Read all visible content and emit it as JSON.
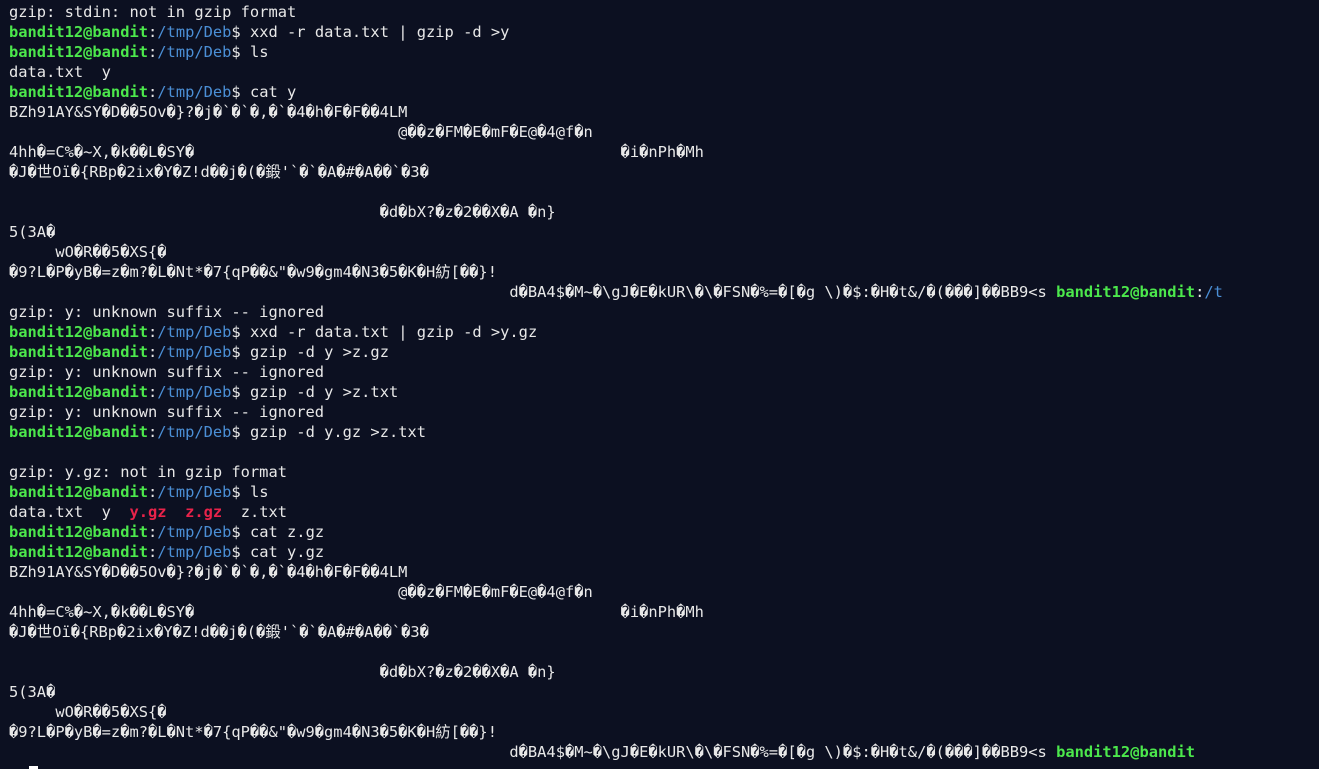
{
  "prompt": {
    "user": "bandit12@bandit",
    "sep": ":",
    "path": "/tmp/Deb",
    "dollar": "$ "
  },
  "lines": [
    {
      "type": "text",
      "text": "gzip: stdin: not in gzip format"
    },
    {
      "type": "cmd",
      "cmd": "xxd -r data.txt | gzip -d >y"
    },
    {
      "type": "cmd",
      "cmd": "ls"
    },
    {
      "type": "text",
      "text": "data.txt  y"
    },
    {
      "type": "cmd",
      "cmd": "cat y"
    },
    {
      "type": "text",
      "text": "BZh91AY&SY�D��5Ov�}?�j�`�`�,�`�4�h�F�F��4LM"
    },
    {
      "type": "text",
      "text": "                                          @��z�FM�E�mF�E@�4@f�n"
    },
    {
      "type": "text",
      "text": "4hh�=C%�~X,�k��L�SY�                                              �i�nPh�Mh"
    },
    {
      "type": "text",
      "text": "�J�世Oï�{RBp�2ix�Y�Z!d��j�(�鍛'`�`�A�#�A��`�3�"
    },
    {
      "type": "text",
      "text": ""
    },
    {
      "type": "text",
      "text": "                                        �d�bX?�z�2��X�A �n}"
    },
    {
      "type": "text",
      "text": "5(3A�"
    },
    {
      "type": "text",
      "text": "     wO�R��5�XS{�"
    },
    {
      "type": "text",
      "text": "�9?L�P�yB�=z�m?�L�Nt*�7{qP��&\"�w9�gm4�N3�5�K�H紡[��}!"
    },
    {
      "type": "tail",
      "text": "                                                      d�BA4$�M~�\\gJ�E�kUR\\�\\�FSN�%=�[�g \\)�$:�H�t&/�(���]��BB9<s ",
      "path": "/t"
    },
    {
      "type": "text",
      "text": "gzip: y: unknown suffix -- ignored"
    },
    {
      "type": "cmd",
      "cmd": "xxd -r data.txt | gzip -d >y.gz"
    },
    {
      "type": "cmd",
      "cmd": "gzip -d y >z.gz"
    },
    {
      "type": "text",
      "text": "gzip: y: unknown suffix -- ignored"
    },
    {
      "type": "cmd",
      "cmd": "gzip -d y >z.txt"
    },
    {
      "type": "text",
      "text": "gzip: y: unknown suffix -- ignored"
    },
    {
      "type": "cmd",
      "cmd": "gzip -d y.gz >z.txt"
    },
    {
      "type": "text",
      "text": ""
    },
    {
      "type": "text",
      "text": "gzip: y.gz: not in gzip format"
    },
    {
      "type": "cmd",
      "cmd": "ls"
    },
    {
      "type": "ls",
      "parts": [
        {
          "text": "data.txt  y  ",
          "archive": false
        },
        {
          "text": "y.gz",
          "archive": true
        },
        {
          "text": "  ",
          "archive": false
        },
        {
          "text": "z.gz",
          "archive": true
        },
        {
          "text": "  z.txt",
          "archive": false
        }
      ]
    },
    {
      "type": "cmd",
      "cmd": "cat z.gz"
    },
    {
      "type": "cmd",
      "cmd": "cat y.gz"
    },
    {
      "type": "text",
      "text": "BZh91AY&SY�D��5Ov�}?�j�`�`�,�`�4�h�F�F��4LM"
    },
    {
      "type": "text",
      "text": "                                          @��z�FM�E�mF�E@�4@f�n"
    },
    {
      "type": "text",
      "text": "4hh�=C%�~X,�k��L�SY�                                              �i�nPh�Mh"
    },
    {
      "type": "text",
      "text": "�J�世Oï�{RBp�2ix�Y�Z!d��j�(�鍛'`�`�A�#�A��`�3�"
    },
    {
      "type": "text",
      "text": ""
    },
    {
      "type": "text",
      "text": "                                        �d�bX?�z�2��X�A �n}"
    },
    {
      "type": "text",
      "text": "5(3A�"
    },
    {
      "type": "text",
      "text": "     wO�R��5�XS{�"
    },
    {
      "type": "text",
      "text": "�9?L�P�yB�=z�m?�L�Nt*�7{qP��&\"�w9�gm4�N3�5�K�H紡[��}!"
    },
    {
      "type": "tail",
      "text": "                                                      d�BA4$�M~�\\gJ�E�kUR\\�\\�FSN�%=�[�g \\)�$:�H�t&/�(���]��BB9<s ",
      "path": ""
    },
    {
      "type": "cursor"
    }
  ]
}
